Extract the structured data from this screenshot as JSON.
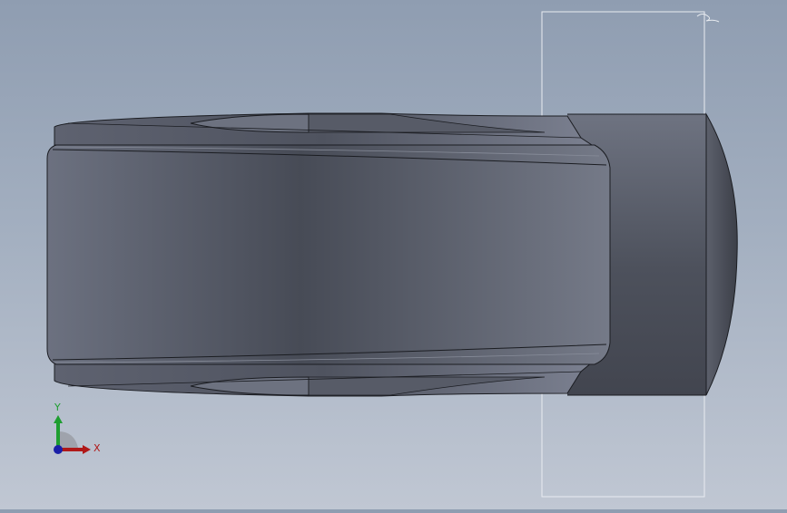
{
  "viewport": {
    "background_top": "#8f9db1",
    "background_bottom": "#c0c7d3",
    "model_color_dark": "#474b56",
    "model_color_light": "#737886",
    "edge_color": "#1b1d22",
    "plane_outline_color": "#e9ecf1"
  },
  "triad": {
    "x_label": "X",
    "y_label": "Y",
    "x_color": "#b01818",
    "y_color": "#1e9e30",
    "z_color": "#1a1fa8"
  }
}
